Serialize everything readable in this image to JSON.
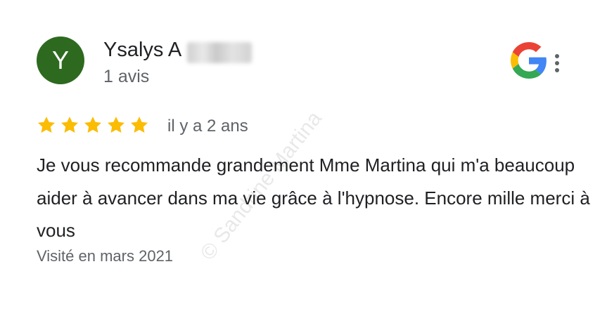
{
  "review": {
    "avatar_letter": "Y",
    "author_name": "Ysalys A",
    "review_count": "1 avis",
    "rating": 5,
    "rating_max": 5,
    "time_ago": "il y a 2 ans",
    "text": "Je vous recommande grandement Mme Martina qui m'a beaucoup aider à avancer dans ma vie grâce à l'hypnose. Encore mille merci à vous",
    "visit": "Visité en mars 2021"
  },
  "watermark": "© Sandrine Martina",
  "icons": {
    "brand": "google-g-icon",
    "menu": "more-vert-icon",
    "star": "star-icon"
  },
  "colors": {
    "avatar_bg": "#2d6a1f",
    "star": "#fbbc04",
    "text_primary": "#202124",
    "text_secondary": "#5f6368"
  }
}
